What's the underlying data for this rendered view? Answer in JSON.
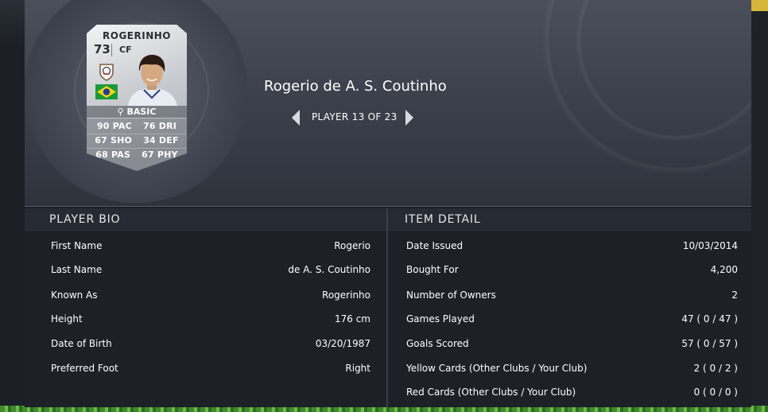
{
  "card": {
    "name": "ROGERINHO",
    "rating": "73",
    "position": "CF",
    "quality": "BASIC",
    "stats": [
      [
        "90 PAC",
        "76 DRI"
      ],
      [
        "67 SHO",
        "34 DEF"
      ],
      [
        "68 PAS",
        "67 PHY"
      ]
    ],
    "colors": {
      "silver": "#c9ccd1",
      "text": "#2a2d33"
    },
    "icons": [
      "club-crest-icon",
      "brazil-flag-icon",
      "player-photo",
      "boot-icon"
    ]
  },
  "player": {
    "full_name": "Rogerio de A. S. Coutinho"
  },
  "pager": {
    "label": "PLAYER 13 OF 23"
  },
  "bio": {
    "title": "PLAYER BIO",
    "rows": [
      {
        "label": "First Name",
        "value": "Rogerio"
      },
      {
        "label": "Last Name",
        "value": "de A. S. Coutinho"
      },
      {
        "label": "Known As",
        "value": "Rogerinho"
      },
      {
        "label": "Height",
        "value": "176 cm"
      },
      {
        "label": "Date of Birth",
        "value": "03/20/1987"
      },
      {
        "label": "Preferred Foot",
        "value": "Right"
      }
    ]
  },
  "item": {
    "title": "ITEM DETAIL",
    "rows": [
      {
        "label": "Date Issued",
        "value": "10/03/2014"
      },
      {
        "label": "Bought For",
        "value": "4,200"
      },
      {
        "label": "Number of Owners",
        "value": "2"
      },
      {
        "label": "Games Played",
        "value": "47 ( 0 / 47 )"
      },
      {
        "label": "Goals Scored",
        "value": "57 ( 0 / 57 )"
      },
      {
        "label": "Yellow Cards (Other Clubs / Your Club)",
        "value": "2 ( 0 / 2 )"
      },
      {
        "label": "Red Cards (Other Clubs / Your Club)",
        "value": "0 ( 0 / 0 )"
      }
    ]
  }
}
